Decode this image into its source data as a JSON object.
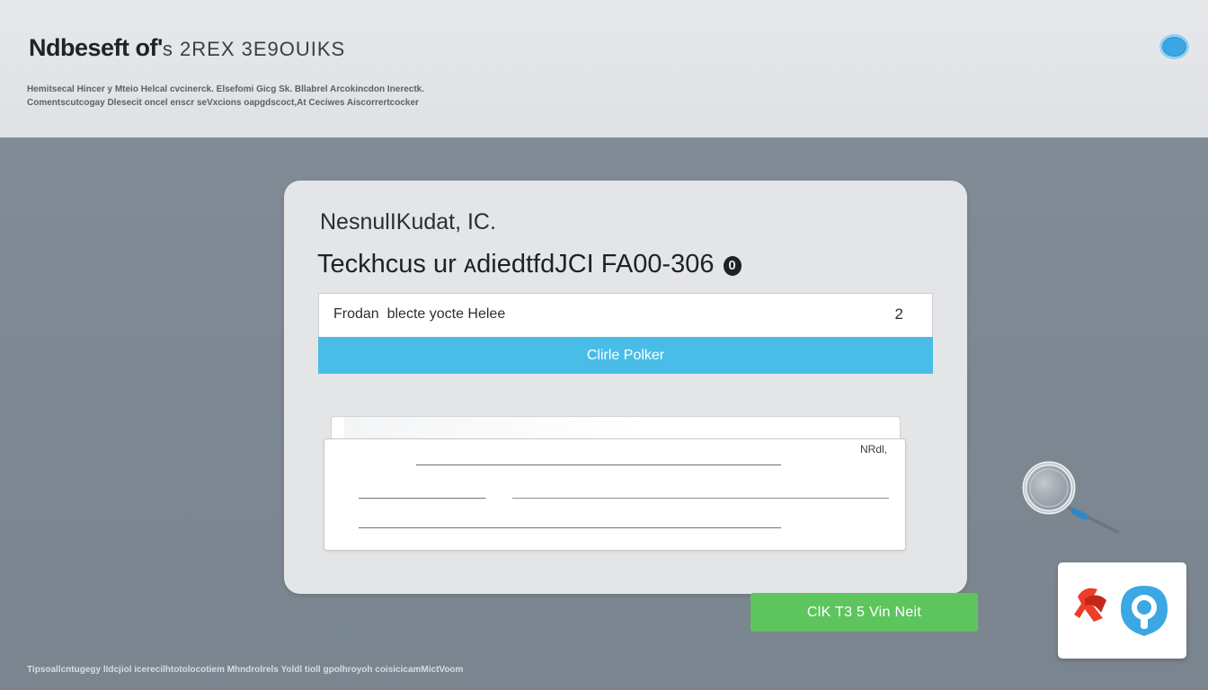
{
  "header": {
    "title_bold": "Ndbeseft of'",
    "title_light": "s 2REX 3E9OUIKS",
    "description_line1": "Hemitsecal Hincer y Mteio Helcal cvcinerck. Elsefomi Gicg Sk. Bllabrel Arcokincdon Inerectk.",
    "description_line2": "Comentscutcogay Dlesecit oncel enscr seVxcions oapgdscoct,At Ceciwes Aiscorrertcocker"
  },
  "status_icon": "status-indicator-icon",
  "card": {
    "subtitle": "NesnulIKudat, IC.",
    "title": "Teckhcus ur⁠ ᴀdiedtfdJCI FA00-306",
    "info_icon_glyph": "0",
    "field": {
      "value": "Frodan  blecte yocte Helee",
      "count": "2"
    },
    "primary_button": "Clirle Polker",
    "panel": {
      "label": "NRdl,"
    }
  },
  "action_button": "ClK T3 5 Vin  Neit",
  "footer": {
    "text": "Tipsoallcntugegy lIdcjiol icerecilhtotolocotiem Mhndrolrels Yoldl tioll gpolhroyoh coisicicamMictVoom"
  },
  "colors": {
    "header_bg": "#e3e5e8",
    "page_bg": "#808b95",
    "primary_button": "#49bde7",
    "action_button": "#5ec55e",
    "status_dot": "#3aa6e3"
  },
  "icons": {
    "magnifier": "magnifier-icon",
    "app_tile": "app-logo-icon"
  }
}
